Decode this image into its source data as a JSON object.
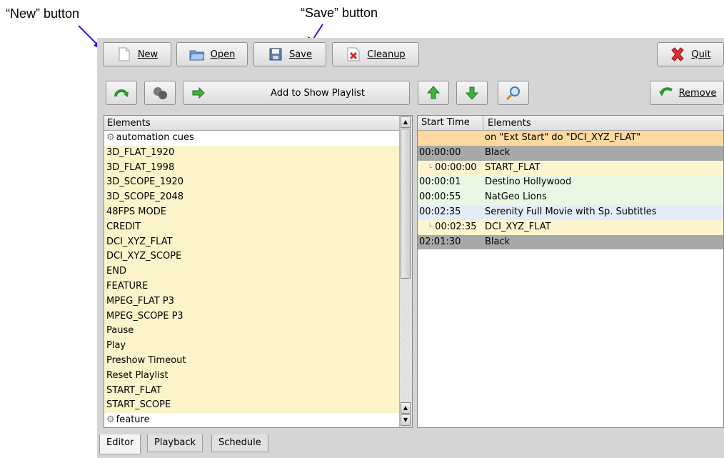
{
  "callouts": {
    "new": "“New” button",
    "save": "“Save” button"
  },
  "toolbar": {
    "new_label": "New",
    "open_label": "Open",
    "save_label": "Save",
    "cleanup_label": "Cleanup",
    "quit_label": "Quit"
  },
  "second_toolbar": {
    "add_label": "Add to Show Playlist",
    "remove_label": "Remove"
  },
  "elements_panel": {
    "header": "Elements",
    "group_automation": "automation cues",
    "items": [
      "3D_FLAT_1920",
      "3D_FLAT_1998",
      "3D_SCOPE_1920",
      "3D_SCOPE_2048",
      "48FPS MODE",
      "CREDIT",
      "DCI_XYZ_FLAT",
      "DCI_XYZ_SCOPE",
      "END",
      "FEATURE",
      "MPEG_FLAT P3",
      "MPEG_SCOPE P3",
      "Pause",
      "Play",
      "Preshow Timeout",
      "Reset Playlist",
      "START_FLAT",
      "START_SCOPE"
    ],
    "group_feature": "feature"
  },
  "playlist": {
    "col_time": "Start Time",
    "col_elements": "Elements",
    "rows": [
      {
        "time": "",
        "element": "on \"Ext Start\" do \"DCI_XYZ_FLAT\"",
        "bg": "#fdd9a0",
        "indent": false
      },
      {
        "time": "00:00:00",
        "element": "Black",
        "bg": "#a8a8a8",
        "indent": false
      },
      {
        "time": "00:00:00",
        "element": "START_FLAT",
        "bg": "#fdf5cf",
        "indent": true
      },
      {
        "time": "00:00:01",
        "element": "Destino Hollywood",
        "bg": "#e8f8e4",
        "indent": false
      },
      {
        "time": "00:00:55",
        "element": "NatGeo Lions",
        "bg": "#e8f8e4",
        "indent": false
      },
      {
        "time": "00:02:35",
        "element": "Serenity Full Movie with Sp. Subtitles",
        "bg": "#e4ecf8",
        "indent": false
      },
      {
        "time": "00:02:35",
        "element": "DCI_XYZ_FLAT",
        "bg": "#fdf5cf",
        "indent": true
      },
      {
        "time": "02:01:30",
        "element": "Black",
        "bg": "#a8a8a8",
        "indent": false
      }
    ]
  },
  "tabs": [
    "Editor",
    "Playback",
    "Schedule"
  ],
  "colors": {
    "cue_row": "#fbf4cb",
    "arrow_blue": "#1a1ae6"
  }
}
